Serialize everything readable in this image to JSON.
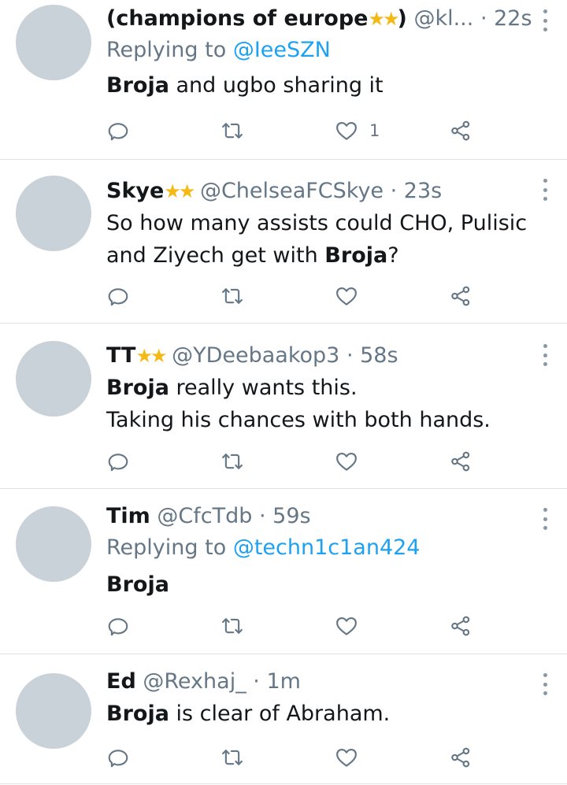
{
  "tweets": [
    {
      "name": "(champions of europe",
      "name_suffix": ")",
      "handle": "@kl...",
      "time": "· 22s",
      "replying_prefix": "Replying to ",
      "replying_to": "@IeeSZN",
      "text_bold": "Broja",
      "text_rest": " and ugbo sharing it",
      "like_count": "1"
    },
    {
      "name": "Skye",
      "handle": "@ChelseaFCSkye",
      "time": "· 23s",
      "text_line1_rest": "So how many assists could CHO, Pulisic",
      "text_line2_pre": "and Ziyech get with ",
      "text_bold": "Broja",
      "text_post": "?"
    },
    {
      "name": "TT",
      "handle": "@YDeebaakop3",
      "time": "· 58s",
      "text_bold": "Broja",
      "text_rest": " really wants this.",
      "text_line2": "Taking his chances with both hands."
    },
    {
      "name": "Tim",
      "handle": "@CfcTdb",
      "time": "· 59s",
      "replying_prefix": "Replying to ",
      "replying_to": "@techn1c1an424",
      "text_bold": "Broja"
    },
    {
      "name": "Ed",
      "handle": "@Rexhaj_",
      "time": "· 1m",
      "text_bold": "Broja",
      "text_rest": " is clear of Abraham."
    }
  ],
  "icons": {
    "reply": "reply-icon",
    "retweet": "retweet-icon",
    "like": "heart-icon",
    "share": "share-icon",
    "more": "more-vertical-icon",
    "star": "star-icon"
  },
  "colors": {
    "link": "#1da1f2",
    "secondary_text": "#657786",
    "avatar": "#c9d2d8",
    "star": "#f5b913",
    "divider": "#dfe3e6"
  }
}
